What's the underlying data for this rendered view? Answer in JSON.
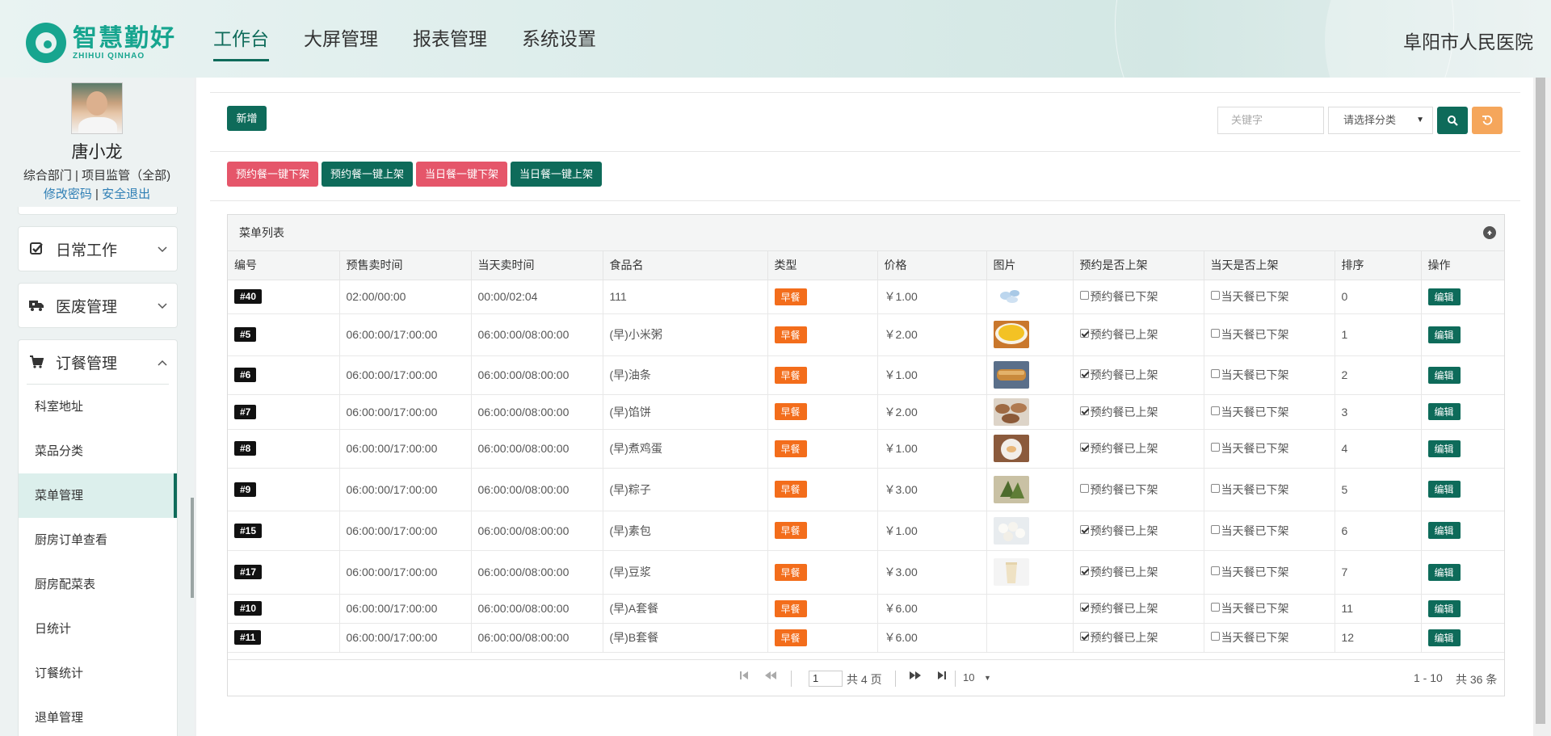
{
  "header": {
    "logo_cn": "智慧勤好",
    "logo_en": "ZHIHUI QINHAO",
    "nav": [
      "工作台",
      "大屏管理",
      "报表管理",
      "系统设置"
    ],
    "hospital": "阜阳市人民医院"
  },
  "user": {
    "name": "唐小龙",
    "dept": "综合部门 | 项目监管（全部)",
    "change_password": "修改密码",
    "separator": "|",
    "logout": "安全退出"
  },
  "sidebar": {
    "menus": [
      {
        "label": "日常工作",
        "icon": "check-square-icon"
      },
      {
        "label": "医废管理",
        "icon": "truck-icon"
      },
      {
        "label": "订餐管理",
        "icon": "cart-icon"
      }
    ],
    "sub_items": [
      "科室地址",
      "菜品分类",
      "菜单管理",
      "厨房订单查看",
      "厨房配菜表",
      "日统计",
      "订餐统计",
      "退单管理"
    ],
    "active_sub": "菜单管理"
  },
  "toolbar": {
    "add": "新增",
    "search_placeholder": "关键字",
    "category_select": "请选择分类",
    "batch_buttons": [
      "预约餐一键下架",
      "预约餐一键上架",
      "当日餐一键下架",
      "当日餐一键上架"
    ]
  },
  "table": {
    "title": "菜单列表",
    "columns": [
      "编号",
      "预售卖时间",
      "当天卖时间",
      "食品名",
      "类型",
      "价格",
      "图片",
      "预约是否上架",
      "当天是否上架",
      "排序",
      "操作"
    ],
    "rows": [
      {
        "id": "#40",
        "presale": "02:00/00:00",
        "sameday": "00:00/02:04",
        "name": "111",
        "type": "早餐",
        "price": "￥1.00",
        "image": "tablets",
        "reserve_on": false,
        "reserve_text": "预约餐已下架",
        "today_on": false,
        "today_text": "当天餐已下架",
        "sort": "0",
        "op": "编辑"
      },
      {
        "id": "#5",
        "presale": "06:00:00/17:00:00",
        "sameday": "06:00:00/08:00:00",
        "name": "(早)小米粥",
        "type": "早餐",
        "price": "￥2.00",
        "image": "millet-porridge",
        "reserve_on": true,
        "reserve_text": "预约餐已上架",
        "today_on": false,
        "today_text": "当天餐已下架",
        "sort": "1",
        "op": "编辑"
      },
      {
        "id": "#6",
        "presale": "06:00:00/17:00:00",
        "sameday": "06:00:00/08:00:00",
        "name": "(早)油条",
        "type": "早餐",
        "price": "￥1.00",
        "image": "fried-dough",
        "reserve_on": true,
        "reserve_text": "预约餐已上架",
        "today_on": false,
        "today_text": "当天餐已下架",
        "sort": "2",
        "op": "编辑"
      },
      {
        "id": "#7",
        "presale": "06:00:00/17:00:00",
        "sameday": "06:00:00/08:00:00",
        "name": "(早)馅饼",
        "type": "早餐",
        "price": "￥2.00",
        "image": "pie",
        "reserve_on": true,
        "reserve_text": "预约餐已上架",
        "today_on": false,
        "today_text": "当天餐已下架",
        "sort": "3",
        "op": "编辑"
      },
      {
        "id": "#8",
        "presale": "06:00:00/17:00:00",
        "sameday": "06:00:00/08:00:00",
        "name": "(早)煮鸡蛋",
        "type": "早餐",
        "price": "￥1.00",
        "image": "boiled-egg",
        "reserve_on": true,
        "reserve_text": "预约餐已上架",
        "today_on": false,
        "today_text": "当天餐已下架",
        "sort": "4",
        "op": "编辑"
      },
      {
        "id": "#9",
        "presale": "06:00:00/17:00:00",
        "sameday": "06:00:00/08:00:00",
        "name": "(早)粽子",
        "type": "早餐",
        "price": "￥3.00",
        "image": "zongzi",
        "reserve_on": false,
        "reserve_text": "预约餐已下架",
        "today_on": false,
        "today_text": "当天餐已下架",
        "sort": "5",
        "op": "编辑"
      },
      {
        "id": "#15",
        "presale": "06:00:00/17:00:00",
        "sameday": "06:00:00/08:00:00",
        "name": "(早)素包",
        "type": "早餐",
        "price": "￥1.00",
        "image": "buns",
        "reserve_on": true,
        "reserve_text": "预约餐已上架",
        "today_on": false,
        "today_text": "当天餐已下架",
        "sort": "6",
        "op": "编辑"
      },
      {
        "id": "#17",
        "presale": "06:00:00/17:00:00",
        "sameday": "06:00:00/08:00:00",
        "name": "(早)豆浆",
        "type": "早餐",
        "price": "￥3.00",
        "image": "soy-milk",
        "reserve_on": true,
        "reserve_text": "预约餐已上架",
        "today_on": false,
        "today_text": "当天餐已下架",
        "sort": "7",
        "op": "编辑"
      },
      {
        "id": "#10",
        "presale": "06:00:00/17:00:00",
        "sameday": "06:00:00/08:00:00",
        "name": "(早)A套餐",
        "type": "早餐",
        "price": "￥6.00",
        "image": "",
        "reserve_on": true,
        "reserve_text": "预约餐已上架",
        "today_on": false,
        "today_text": "当天餐已下架",
        "sort": "11",
        "op": "编辑"
      },
      {
        "id": "#11",
        "presale": "06:00:00/17:00:00",
        "sameday": "06:00:00/08:00:00",
        "name": "(早)B套餐",
        "type": "早餐",
        "price": "￥6.00",
        "image": "",
        "reserve_on": true,
        "reserve_text": "预约餐已上架",
        "today_on": false,
        "today_text": "当天餐已下架",
        "sort": "12",
        "op": "编辑"
      }
    ]
  },
  "pager": {
    "page": "1",
    "total_pages": "共 4 页",
    "page_size": "10",
    "range": "1 - 10",
    "total": "共 36 条"
  },
  "colors": {
    "primary": "#0e6b5a",
    "danger": "#e5566a",
    "badge_orange": "#f36d1b",
    "reset_orange": "#f5a65b"
  }
}
